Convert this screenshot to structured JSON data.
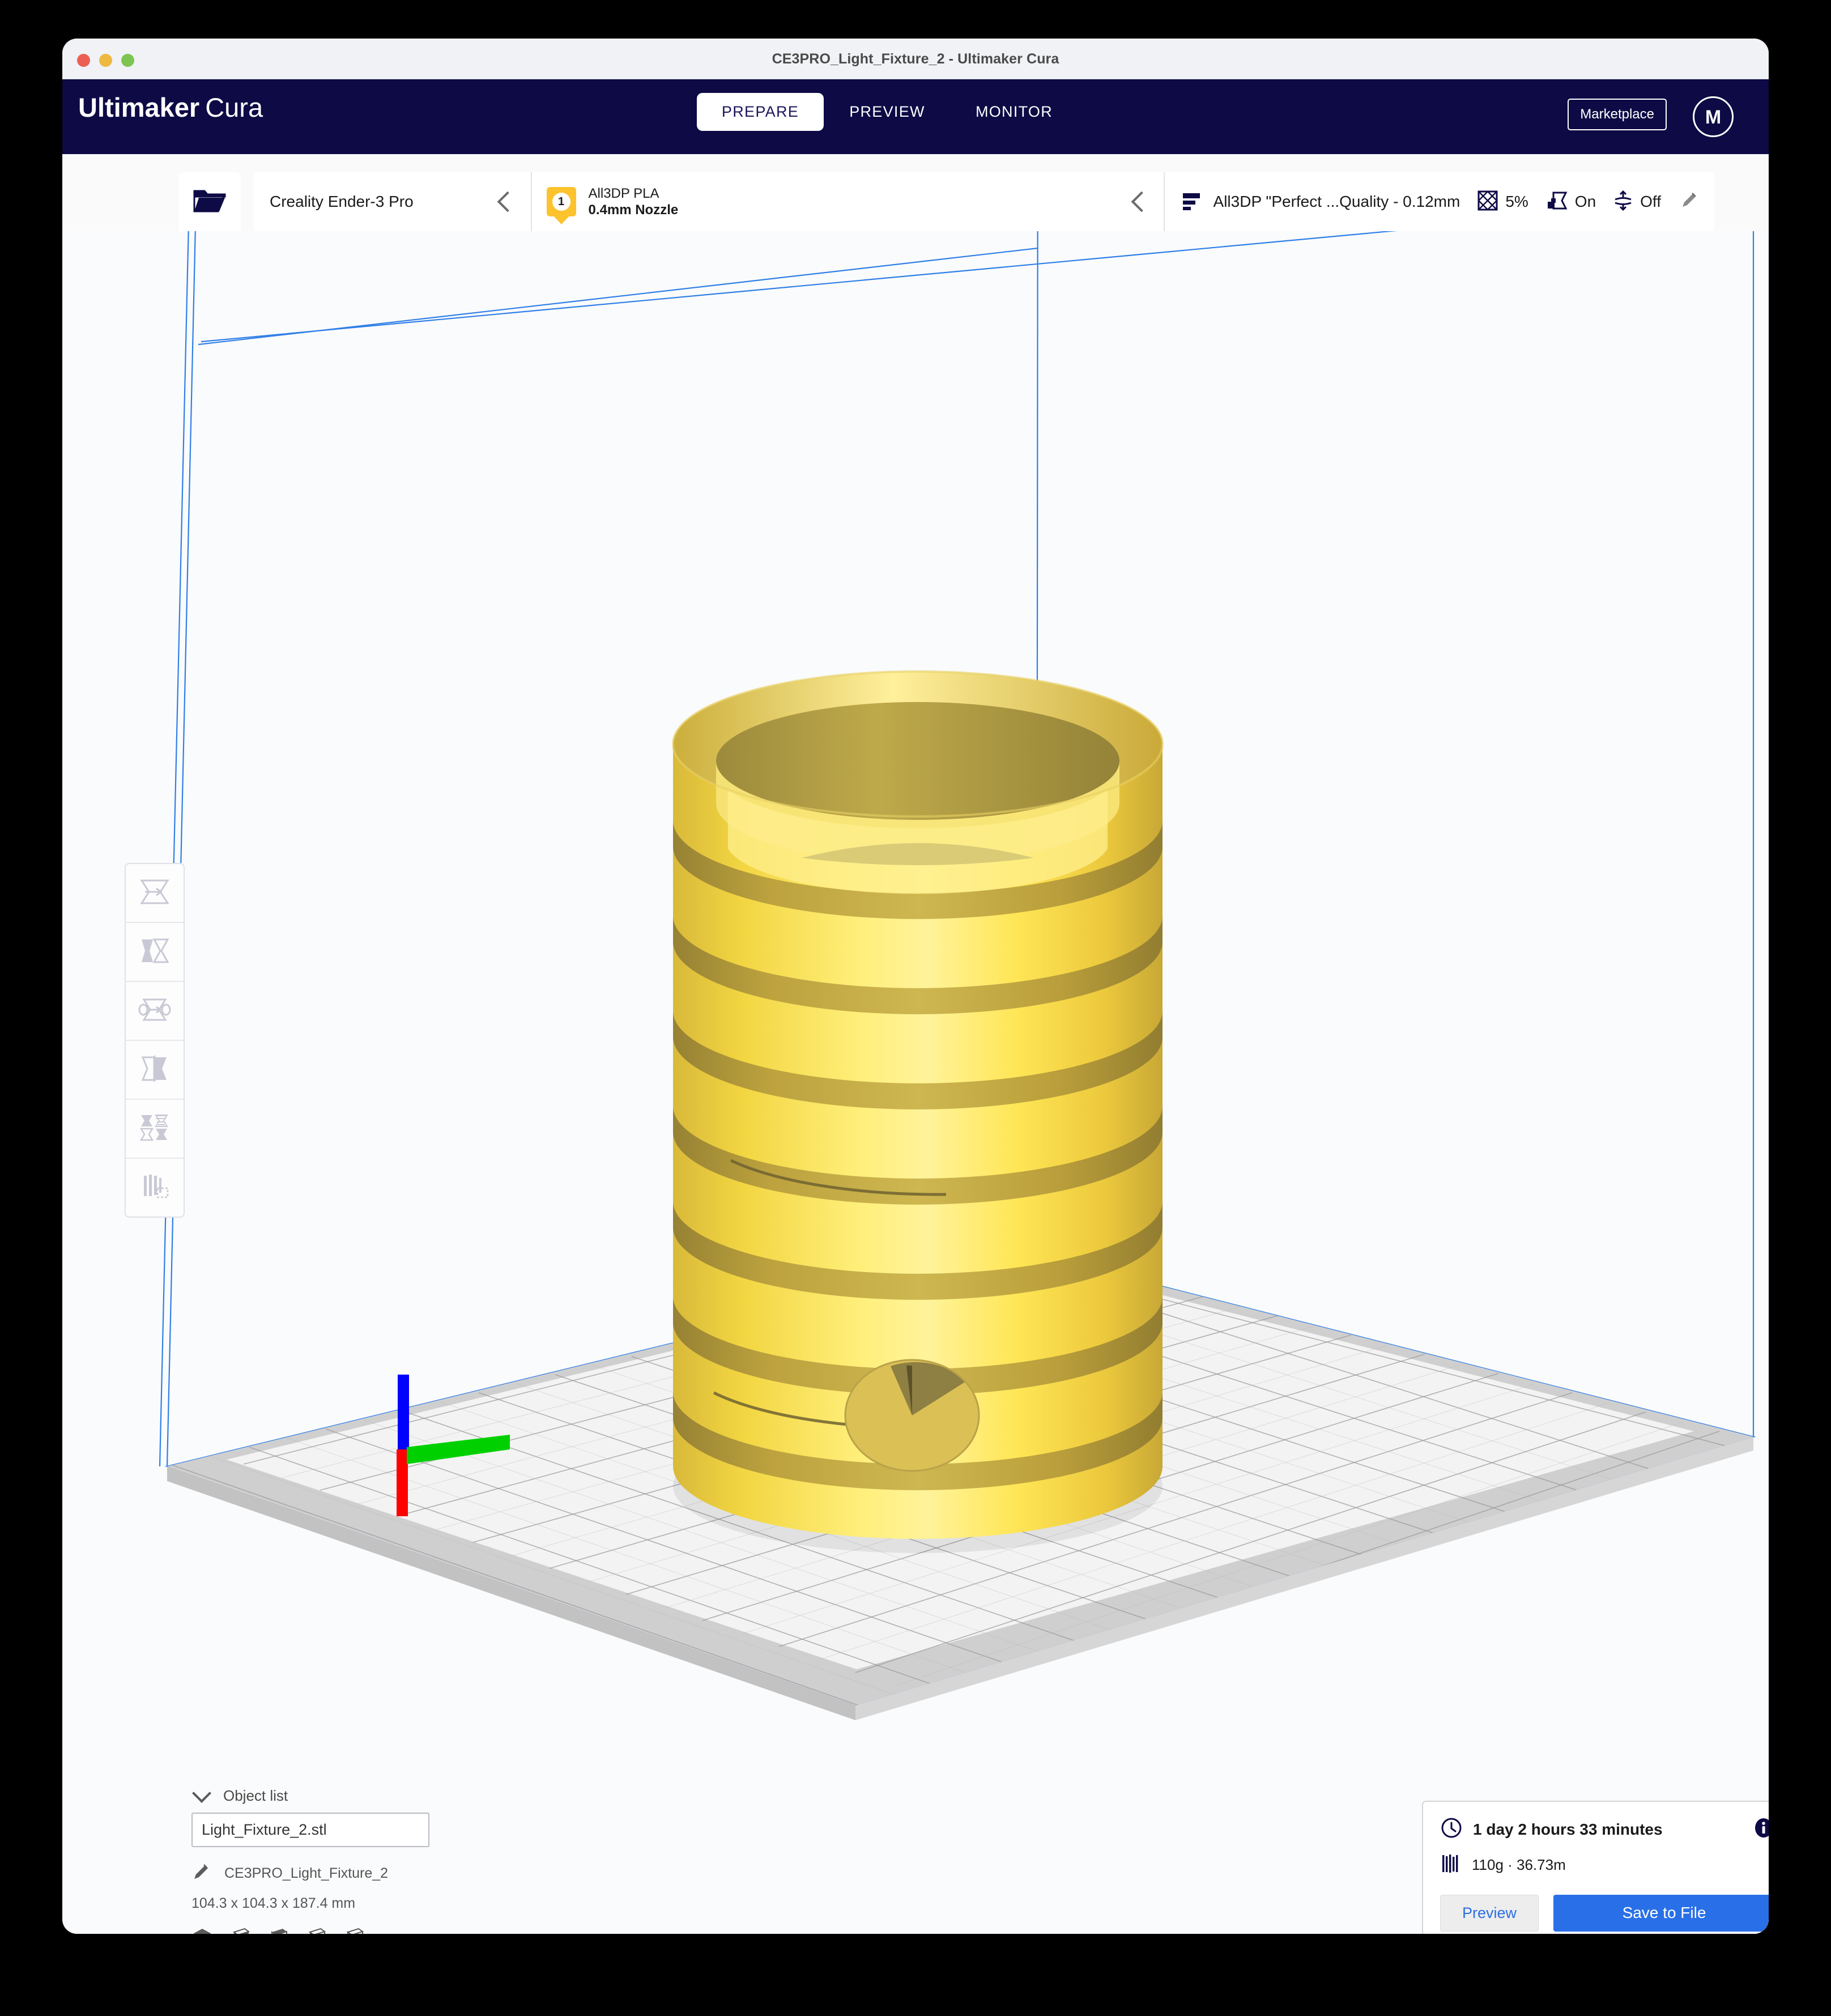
{
  "window": {
    "title": "CE3PRO_Light_Fixture_2 - Ultimaker Cura"
  },
  "header": {
    "brand_bold": "Ultimaker",
    "brand_light": "Cura",
    "tabs": [
      {
        "label": "PREPARE",
        "active": true
      },
      {
        "label": "PREVIEW",
        "active": false
      },
      {
        "label": "MONITOR",
        "active": false
      }
    ],
    "marketplace_label": "Marketplace",
    "avatar_initial": "M",
    "navy": "#0d0a45"
  },
  "config_bar": {
    "open_file_icon": "open-folder-icon",
    "printer": {
      "name": "Creality Ender-3 Pro"
    },
    "material": {
      "extruder_number": "1",
      "name": "All3DP PLA",
      "nozzle": "0.4mm Nozzle",
      "badge_color": "#fcc32e"
    },
    "quality": {
      "profile": "All3DP \"Perfect ...Quality - 0.12mm",
      "infill_label": "5%",
      "support_label": "On",
      "adhesion_label": "Off"
    }
  },
  "tools": [
    {
      "name": "move-tool",
      "label": "Move"
    },
    {
      "name": "scale-tool",
      "label": "Scale"
    },
    {
      "name": "rotate-tool",
      "label": "Rotate"
    },
    {
      "name": "mirror-tool",
      "label": "Mirror"
    },
    {
      "name": "per-model-settings-tool",
      "label": "Per Model Settings"
    },
    {
      "name": "support-blocker-tool",
      "label": "Support Blocker"
    }
  ],
  "object_list": {
    "title": "Object list",
    "file_name": "Light_Fixture_2.stl",
    "model_name": "CE3PRO_Light_Fixture_2",
    "dimensions": "104.3 x 104.3 x 187.4 mm",
    "view_icons": [
      "view-3d-icon",
      "view-front-icon",
      "view-top-icon",
      "view-left-icon",
      "view-right-icon"
    ]
  },
  "print_info": {
    "time": "1 day 2 hours 33 minutes",
    "material": "110g · 36.73m",
    "preview_label": "Preview",
    "save_label": "Save to File",
    "accent_blue": "#2970e8"
  },
  "scene": {
    "model_color_light": "#ffe85c",
    "model_color_mid": "#f5d836",
    "model_color_dark": "#b8a04a",
    "buildplate_color": "#f2f2f2",
    "disallowed_color": "#cfcfcf",
    "volume_outline_color": "#2f7fe8",
    "axis_x_color": "#ff0000",
    "axis_y_color": "#00d000",
    "axis_z_color": "#0000ff"
  }
}
